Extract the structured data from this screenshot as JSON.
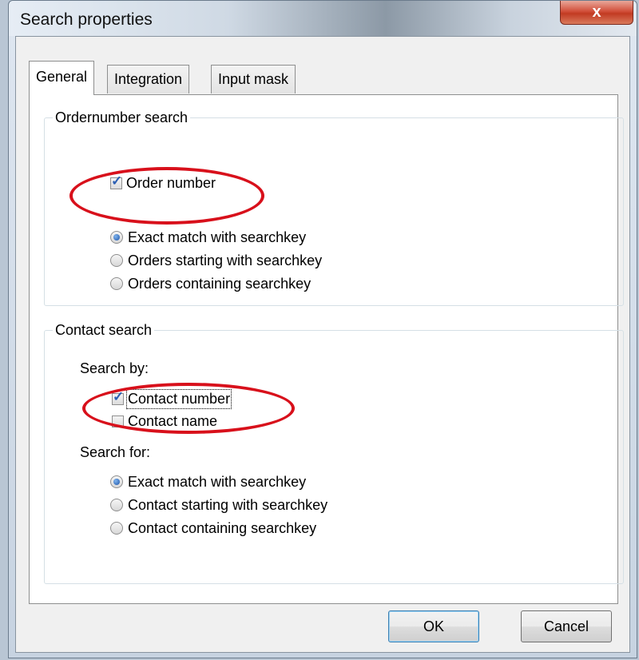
{
  "window": {
    "title": "Search properties",
    "close_label": "x"
  },
  "tabs": [
    {
      "label": "General",
      "active": true
    },
    {
      "label": "Integration",
      "active": false
    },
    {
      "label": "Input mask",
      "active": false
    }
  ],
  "order_search": {
    "legend": "Ordernumber search",
    "order_number_label": "Order number",
    "order_number_checked": true,
    "options": [
      {
        "label": "Exact match with searchkey",
        "selected": true
      },
      {
        "label": "Orders starting with searchkey",
        "selected": false
      },
      {
        "label": "Orders containing searchkey",
        "selected": false
      }
    ]
  },
  "contact_search": {
    "legend": "Contact search",
    "search_by_label": "Search by:",
    "contact_number_label": "Contact number",
    "contact_number_checked": true,
    "contact_name_label": "Contact name",
    "contact_name_checked": false,
    "search_for_label": "Search for:",
    "options": [
      {
        "label": "Exact match with searchkey",
        "selected": true
      },
      {
        "label": "Contact starting with searchkey",
        "selected": false
      },
      {
        "label": "Contact containing searchkey",
        "selected": false
      }
    ]
  },
  "buttons": {
    "ok_label": "OK",
    "cancel_label": "Cancel"
  },
  "colors": {
    "annotation": "#d8101b",
    "check": "#2b5fb3",
    "radio_selected": "#1d54a8"
  }
}
